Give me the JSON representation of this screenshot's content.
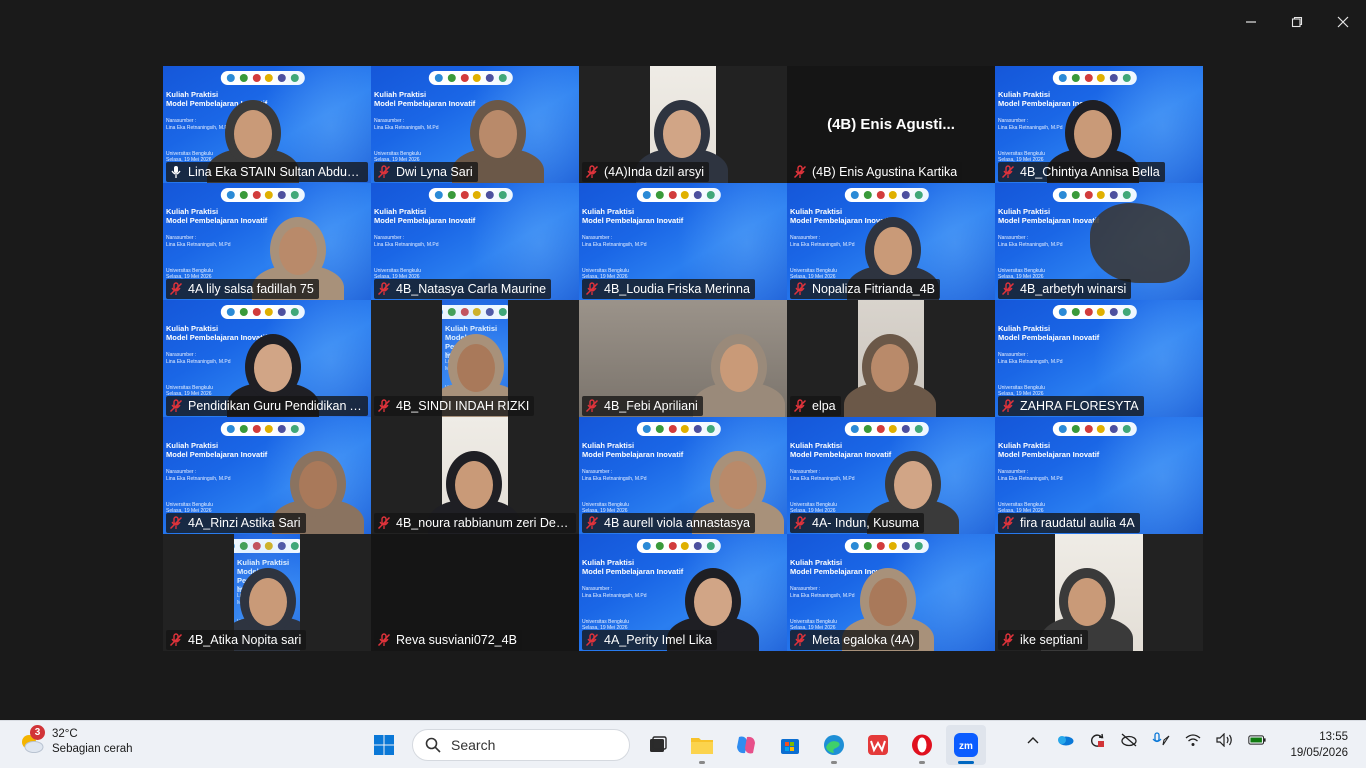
{
  "window": {
    "controls": [
      "minimize",
      "restore",
      "close"
    ]
  },
  "meeting": {
    "slide": {
      "title_line1": "Kuliah Praktisi",
      "title_line2": "Model Pembelajaran Inovatif",
      "narasumber_label": "Narasumber :",
      "narasumber": "Lina Eka Retnaningsih, M.Pd",
      "univ": "Universitas Bengkulu",
      "date": "Selasa, 19 Mei 2026"
    },
    "participants": [
      {
        "name": "Lina Eka STAIN Sultan Abdurr...",
        "view": "slide-person",
        "muted": false,
        "active": true
      },
      {
        "name": "Dwi Lyna Sari",
        "view": "slide-person",
        "muted": true
      },
      {
        "name": "(4A)Inda dzil arsyi",
        "view": "cam-narrow",
        "muted": true
      },
      {
        "name": "(4B) Enis Agustina Kartika",
        "view": "no-video",
        "big_label": "(4B) Enis Agusti...",
        "muted": true
      },
      {
        "name": "4B_Chintiya Annisa Bella",
        "view": "slide-person",
        "muted": true
      },
      {
        "name": "4A lily salsa fadillah 75",
        "view": "slide-person",
        "muted": true
      },
      {
        "name": "4B_Natasya Carla Maurine",
        "view": "slide",
        "muted": true
      },
      {
        "name": "4B_Loudia Friska Merinna",
        "view": "slide",
        "muted": true
      },
      {
        "name": "Nopaliza Fitrianda_4B",
        "view": "slide-person",
        "muted": true
      },
      {
        "name": "4B_arbetyh winarsi",
        "view": "slide-object",
        "muted": true
      },
      {
        "name": "Pendidikan Guru Pendidikan A...",
        "view": "slide-person",
        "muted": true
      },
      {
        "name": "4B_SINDI INDAH RIZKI",
        "view": "slide-narrow",
        "muted": true
      },
      {
        "name": "4B_Febi Apriliani",
        "view": "cam-wide",
        "muted": true
      },
      {
        "name": "elpa",
        "view": "cam-narrow",
        "muted": true
      },
      {
        "name": "ZAHRA FLORESYTA",
        "view": "slide",
        "muted": true
      },
      {
        "name": "4A_Rinzi Astika Sari",
        "view": "slide-person",
        "muted": true
      },
      {
        "name": "4B_noura rabbianum zeri Dew...",
        "view": "cam-narrow",
        "muted": true
      },
      {
        "name": "4B aurell viola annastasya",
        "view": "slide-person",
        "muted": true
      },
      {
        "name": "4A- Indun, Kusuma",
        "view": "slide-person",
        "muted": true
      },
      {
        "name": "fira raudatul aulia 4A",
        "view": "slide",
        "muted": true
      },
      {
        "name": "4B_Atika Nopita sari",
        "view": "slide-narrow",
        "muted": true
      },
      {
        "name": "Reva susviani072_4B",
        "view": "black",
        "muted": true
      },
      {
        "name": "4A_Perity Imel Lika",
        "view": "slide-person",
        "muted": true
      },
      {
        "name": "Meta egaloka (4A)",
        "view": "slide-person",
        "muted": true
      },
      {
        "name": "ike septiani",
        "view": "cam-narrow",
        "muted": true
      }
    ]
  },
  "taskbar": {
    "weather": {
      "badge": "3",
      "temp": "32°C",
      "desc": "Sebagian cerah"
    },
    "search_placeholder": "Search",
    "clock": {
      "time": "13:55",
      "date": "19/05/2026"
    },
    "apps": [
      "start-icon",
      "search",
      "task-view-icon",
      "file-explorer-icon",
      "copilot-icon",
      "store-icon",
      "edge-icon",
      "wps-icon",
      "opera-icon",
      "zoom-icon"
    ],
    "colors": {
      "accent": "#0067c0",
      "active_speaker": "#23d959",
      "muted_mic": "#e0333b"
    }
  }
}
